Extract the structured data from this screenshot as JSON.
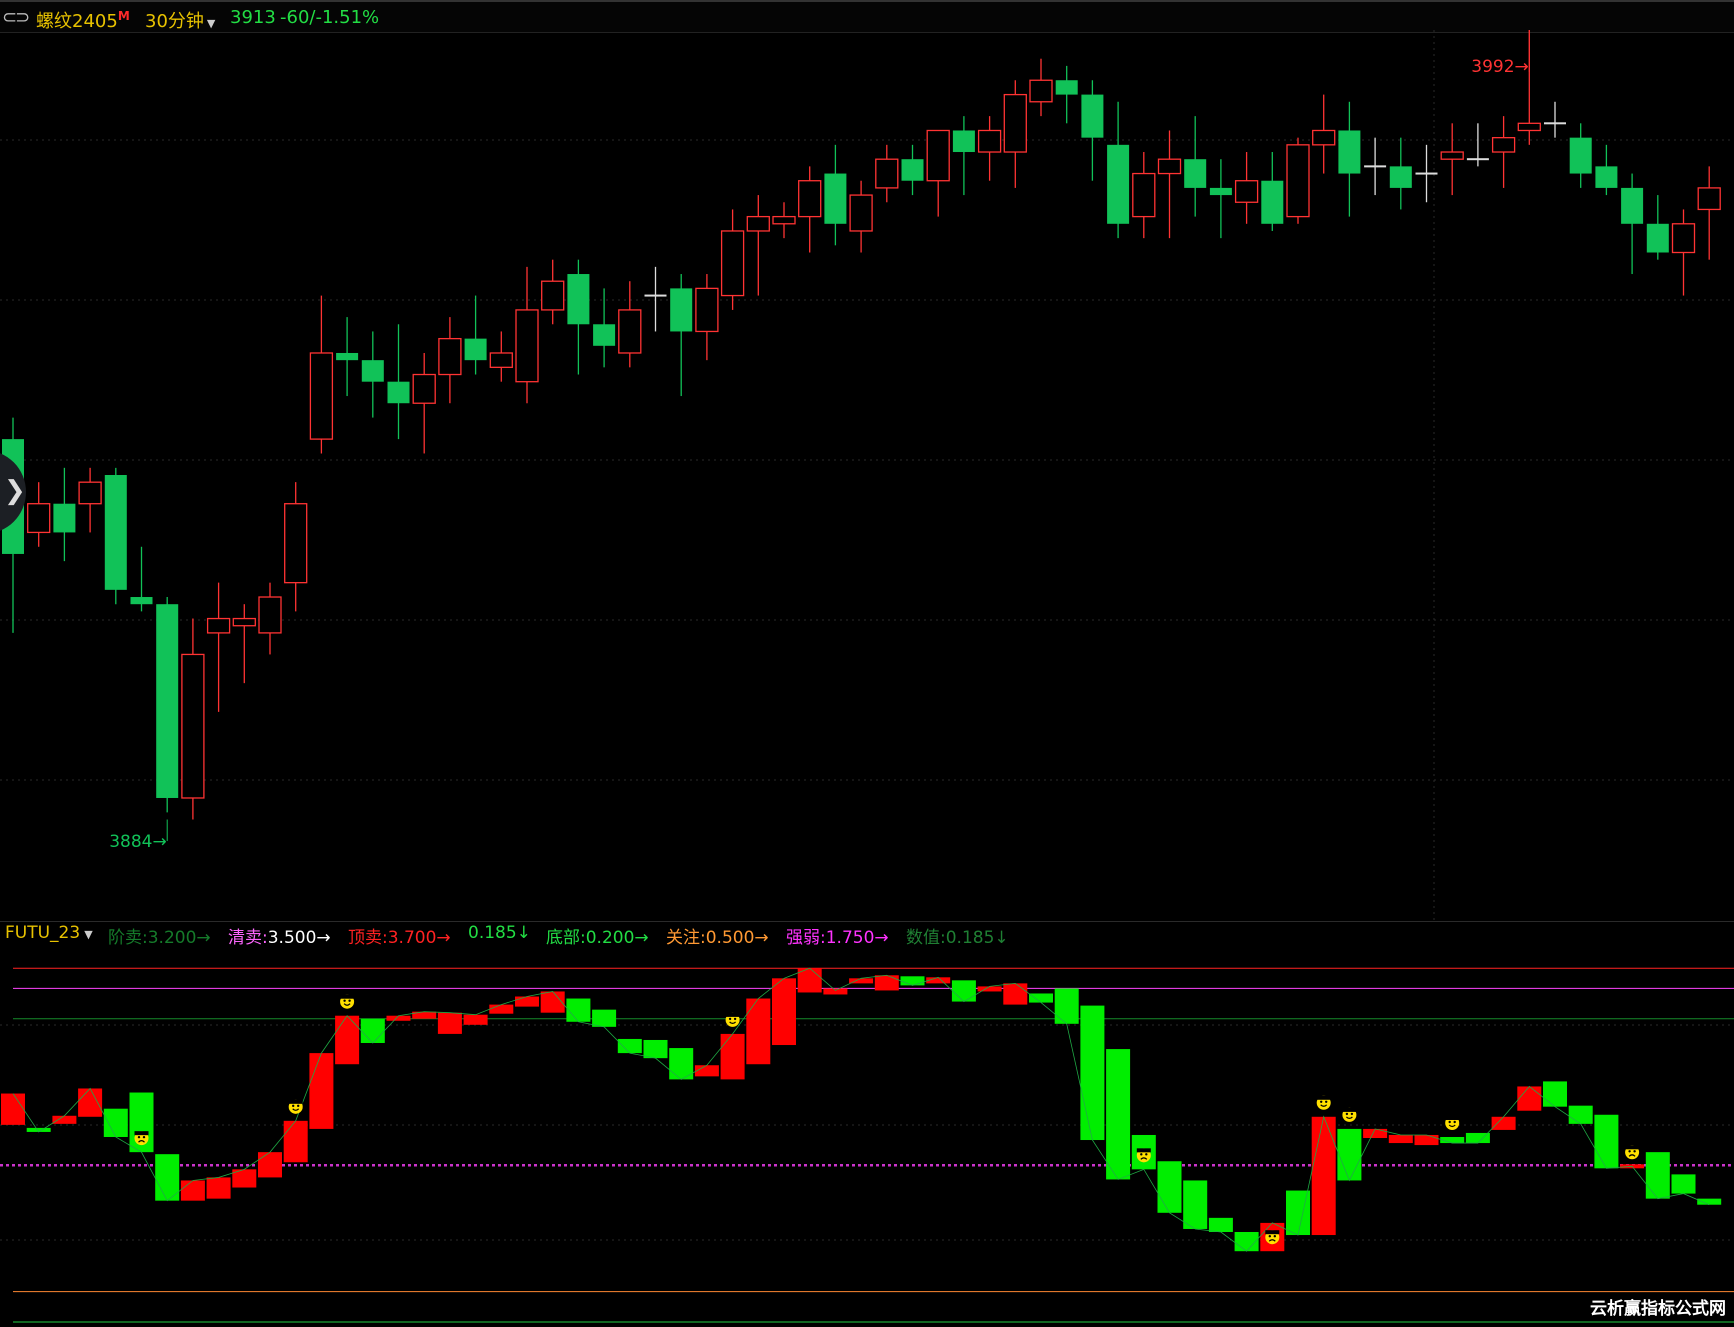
{
  "header": {
    "nav_icon": "back-forward-icon",
    "symbol": "螺纹2405",
    "symbol_badge": "M",
    "period": "30分钟",
    "price": "3913",
    "change": "-60/-1.51%"
  },
  "indicator": {
    "name": "FUTU_23",
    "params": [
      {
        "label": "阶卖",
        "value": "3.200",
        "arrow": "→",
        "label_color": "#157a2a",
        "value_color": "#157a2a"
      },
      {
        "label": "清卖",
        "value": "3.500",
        "arrow": "→",
        "label_color": "#ff66ff",
        "value_color": "#ffffff"
      },
      {
        "label": "顶卖",
        "value": "3.700",
        "arrow": "→",
        "label_color": "#ff2222",
        "value_color": "#ff2222"
      },
      {
        "label": "",
        "value": "0.185",
        "arrow": "↓",
        "label_color": "#22dd44",
        "value_color": "#22dd44"
      },
      {
        "label": "底部",
        "value": "0.200",
        "arrow": "→",
        "label_color": "#22dd44",
        "value_color": "#22dd44"
      },
      {
        "label": "关注",
        "value": "0.500",
        "arrow": "→",
        "label_color": "#ff9933",
        "value_color": "#ff9933"
      },
      {
        "label": "强弱",
        "value": "1.750",
        "arrow": "→",
        "label_color": "#ff33ff",
        "value_color": "#ff33ff"
      },
      {
        "label": "数值",
        "value": "0.185",
        "arrow": "↓",
        "label_color": "#1f7f33",
        "value_color": "#1f7f33"
      }
    ]
  },
  "side_tab_icon": "chevron-right-icon",
  "watermark": "云析赢指标公式网",
  "colors": {
    "up": "#ff3333",
    "down": "#11c258",
    "bar_up": "#ff0000",
    "bar_down": "#00ee00",
    "level_line": "#cc33cc"
  },
  "chart_data": [
    {
      "type": "candlestick",
      "annotations": [
        {
          "label": "3992",
          "marker": "→",
          "type": "high"
        },
        {
          "label": "3884",
          "marker": "→",
          "type": "low"
        }
      ],
      "ylim": [
        3873,
        3997
      ],
      "candles": [
        [
          3940,
          3924,
          3943,
          3913
        ],
        [
          3927,
          3931,
          3934,
          3925
        ],
        [
          3931,
          3927,
          3936,
          3923
        ],
        [
          3931,
          3934,
          3936,
          3927
        ],
        [
          3935,
          3919,
          3936,
          3917
        ],
        [
          3918,
          3917,
          3925,
          3916
        ],
        [
          3917,
          3890,
          3918,
          3888
        ],
        [
          3890,
          3910,
          3915,
          3887
        ],
        [
          3913,
          3915,
          3920,
          3902
        ],
        [
          3914,
          3915,
          3917,
          3906
        ],
        [
          3913,
          3918,
          3920,
          3910
        ],
        [
          3920,
          3931,
          3934,
          3916
        ],
        [
          3940,
          3952,
          3960,
          3938
        ],
        [
          3952,
          3951,
          3957,
          3946
        ],
        [
          3951,
          3948,
          3955,
          3943
        ],
        [
          3948,
          3945,
          3956,
          3940
        ],
        [
          3945,
          3949,
          3952,
          3938
        ],
        [
          3949,
          3954,
          3957,
          3945
        ],
        [
          3954,
          3951,
          3960,
          3949
        ],
        [
          3950,
          3952,
          3955,
          3948
        ],
        [
          3948,
          3958,
          3964,
          3945
        ],
        [
          3958,
          3962,
          3965,
          3956
        ],
        [
          3963,
          3956,
          3965,
          3949
        ],
        [
          3956,
          3953,
          3961,
          3950
        ],
        [
          3952,
          3958,
          3962,
          3950
        ],
        [
          3960,
          3960,
          3964,
          3955
        ],
        [
          3961,
          3955,
          3963,
          3946
        ],
        [
          3955,
          3961,
          3963,
          3951
        ],
        [
          3960,
          3969,
          3972,
          3958
        ],
        [
          3969,
          3971,
          3974,
          3960
        ],
        [
          3970,
          3971,
          3973,
          3968
        ],
        [
          3971,
          3976,
          3978,
          3966
        ],
        [
          3977,
          3970,
          3981,
          3967
        ],
        [
          3969,
          3974,
          3976,
          3966
        ],
        [
          3975,
          3979,
          3981,
          3973
        ],
        [
          3979,
          3976,
          3981,
          3974
        ],
        [
          3976,
          3983,
          3983,
          3971
        ],
        [
          3983,
          3980,
          3985,
          3974
        ],
        [
          3980,
          3983,
          3985,
          3976
        ],
        [
          3980,
          3988,
          3990,
          3975
        ],
        [
          3987,
          3990,
          3993,
          3985
        ],
        [
          3990,
          3988,
          3992,
          3984
        ],
        [
          3988,
          3982,
          3990,
          3976
        ],
        [
          3981,
          3970,
          3987,
          3968
        ],
        [
          3971,
          3977,
          3980,
          3968
        ],
        [
          3977,
          3979,
          3983,
          3968
        ],
        [
          3979,
          3975,
          3985,
          3971
        ],
        [
          3975,
          3974,
          3979,
          3968
        ],
        [
          3973,
          3976,
          3980,
          3970
        ],
        [
          3976,
          3970,
          3980,
          3969
        ],
        [
          3971,
          3981,
          3982,
          3970
        ],
        [
          3981,
          3983,
          3988,
          3977
        ],
        [
          3983,
          3977,
          3987,
          3971
        ],
        [
          3978,
          3978,
          3982,
          3974
        ],
        [
          3978,
          3975,
          3982,
          3972
        ],
        [
          3977,
          3977,
          3981,
          3973
        ],
        [
          3979,
          3980,
          3984,
          3974
        ],
        [
          3979,
          3979,
          3984,
          3978
        ],
        [
          3980,
          3982,
          3985,
          3975
        ],
        [
          3983,
          3984,
          3997,
          3981
        ],
        [
          3984,
          3984,
          3987,
          3982
        ],
        [
          3982,
          3977,
          3984,
          3975
        ],
        [
          3978,
          3975,
          3981,
          3974
        ],
        [
          3975,
          3970,
          3977,
          3963
        ],
        [
          3970,
          3966,
          3974,
          3965
        ],
        [
          3966,
          3970,
          3972,
          3960
        ],
        [
          3972,
          3975,
          3978,
          3965
        ]
      ]
    },
    {
      "type": "bar",
      "title": "FUTU_23",
      "reference_lines": [
        {
          "name": "顶卖",
          "value": 3.7
        },
        {
          "name": "清卖",
          "value": 3.5
        },
        {
          "name": "阶卖",
          "value": 3.2
        },
        {
          "name": "强弱",
          "value": 1.75
        },
        {
          "name": "关注",
          "value": 0.5
        },
        {
          "name": "底部",
          "value": 0.2
        }
      ],
      "ylim": [
        0.15,
        3.9
      ],
      "bars": [
        [
          2.15,
          2.46
        ],
        [
          2.12,
          2.08
        ],
        [
          2.16,
          2.24
        ],
        [
          2.23,
          2.51
        ],
        [
          2.31,
          2.03
        ],
        [
          2.47,
          1.88
        ],
        [
          1.86,
          1.4
        ],
        [
          1.4,
          1.6
        ],
        [
          1.42,
          1.63
        ],
        [
          1.53,
          1.71
        ],
        [
          1.63,
          1.88
        ],
        [
          1.78,
          2.19
        ],
        [
          2.11,
          2.86
        ],
        [
          2.75,
          3.23
        ],
        [
          3.2,
          2.96
        ],
        [
          3.18,
          3.23
        ],
        [
          3.2,
          3.27
        ],
        [
          3.05,
          3.26
        ],
        [
          3.14,
          3.24
        ],
        [
          3.25,
          3.34
        ],
        [
          3.32,
          3.42
        ],
        [
          3.26,
          3.47
        ],
        [
          3.4,
          3.17
        ],
        [
          3.29,
          3.12
        ],
        [
          3.0,
          2.86
        ],
        [
          2.99,
          2.81
        ],
        [
          2.91,
          2.6
        ],
        [
          2.63,
          2.74
        ],
        [
          2.6,
          3.05
        ],
        [
          2.75,
          3.4
        ],
        [
          2.94,
          3.6
        ],
        [
          3.46,
          3.7
        ],
        [
          3.46,
          3.48
        ],
        [
          3.55,
          3.6
        ],
        [
          3.48,
          3.63
        ],
        [
          3.62,
          3.53
        ],
        [
          3.55,
          3.61
        ],
        [
          3.58,
          3.37
        ],
        [
          3.47,
          3.52
        ],
        [
          3.34,
          3.55
        ],
        [
          3.45,
          3.36
        ],
        [
          3.5,
          3.15
        ],
        [
          3.33,
          2.0
        ],
        [
          2.9,
          1.61
        ],
        [
          2.05,
          1.71
        ],
        [
          1.79,
          1.28
        ],
        [
          1.6,
          1.12
        ],
        [
          1.23,
          1.09
        ],
        [
          1.09,
          0.9
        ],
        [
          0.9,
          1.18
        ],
        [
          1.5,
          1.06
        ],
        [
          1.06,
          2.23
        ],
        [
          2.11,
          1.6
        ],
        [
          2.02,
          2.11
        ],
        [
          1.97,
          2.05
        ],
        [
          1.95,
          2.05
        ],
        [
          2.03,
          1.97
        ],
        [
          2.07,
          1.97
        ],
        [
          2.1,
          2.23
        ],
        [
          2.29,
          2.53
        ],
        [
          2.58,
          2.33
        ],
        [
          2.34,
          2.16
        ],
        [
          2.25,
          1.72
        ],
        [
          1.74,
          1.74
        ],
        [
          1.88,
          1.42
        ],
        [
          1.66,
          1.47
        ],
        [
          1.42,
          1.36
        ]
      ],
      "smiley_icons": [
        {
          "index": 5,
          "mood": "sad"
        },
        {
          "index": 11,
          "mood": "happy"
        },
        {
          "index": 13,
          "mood": "happy"
        },
        {
          "index": 28,
          "mood": "happy"
        },
        {
          "index": 44,
          "mood": "sad"
        },
        {
          "index": 49,
          "mood": "sad"
        },
        {
          "index": 51,
          "mood": "happy"
        },
        {
          "index": 52,
          "mood": "happy"
        },
        {
          "index": 56,
          "mood": "happy"
        },
        {
          "index": 63,
          "mood": "sad"
        }
      ]
    }
  ]
}
